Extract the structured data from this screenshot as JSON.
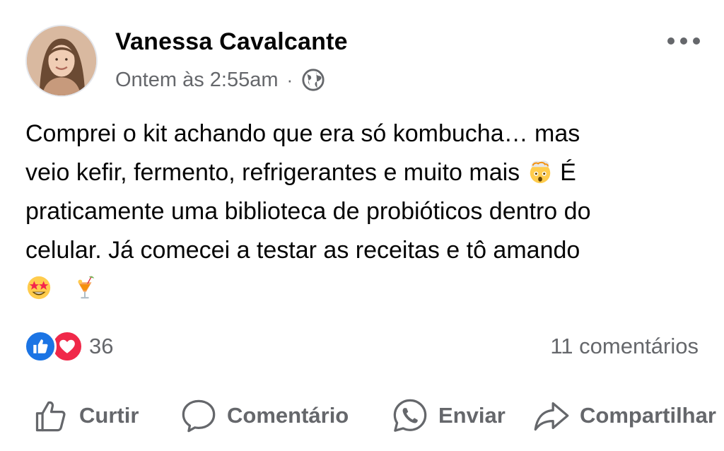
{
  "post": {
    "author": "Vanessa Cavalcante",
    "timestamp": "Ontem às 2:55am",
    "separator": "·",
    "privacy_icon": "globe-icon",
    "text_line1": "Comprei o kit achando que era só kombucha… mas",
    "text_line2a": "veio kefir, fermento, refrigerantes e muito mais",
    "text_line2b": "É",
    "text_line3": "praticamente uma biblioteca de probióticos dentro do",
    "text_line4": "celular. Já comecei a testar as receitas e tô amando",
    "emojis": [
      "exploding-head-emoji",
      "star-struck-emoji",
      "tropical-drink-emoji"
    ]
  },
  "engagement": {
    "reactions": [
      "like-reaction-icon",
      "love-reaction-icon"
    ],
    "reaction_count": "36",
    "comments": "11 comentários"
  },
  "actions": {
    "like": "Curtir",
    "comment": "Comentário",
    "send": "Enviar",
    "share": "Compartilhar"
  },
  "colors": {
    "like_blue": "#1b74e4",
    "love_red": "#f02849",
    "secondary_text": "#65676b"
  }
}
